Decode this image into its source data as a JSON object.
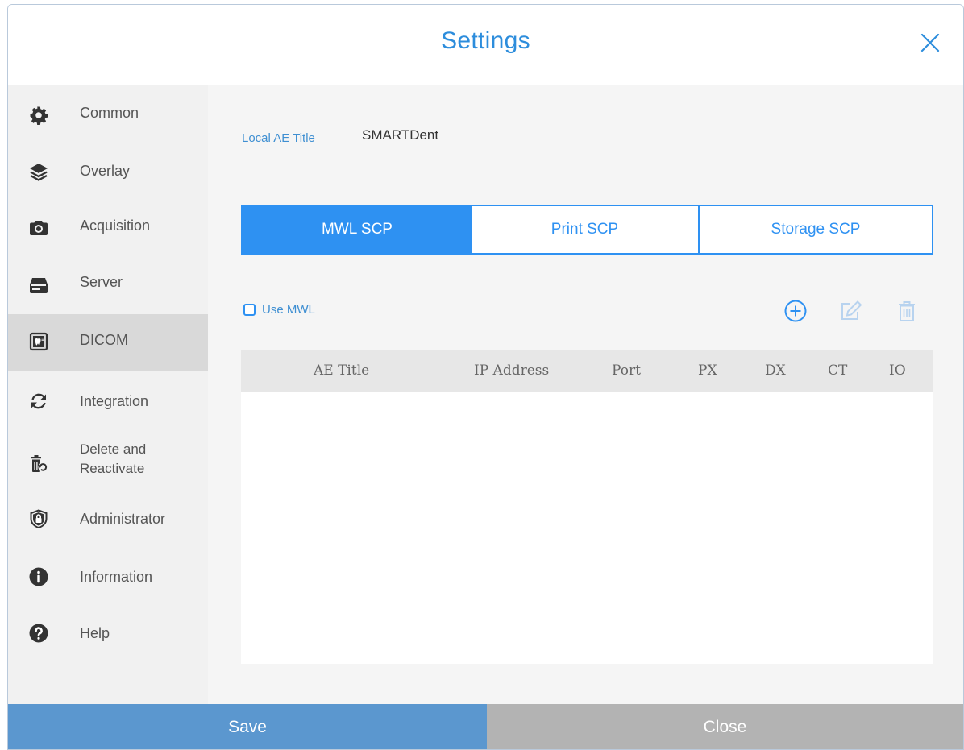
{
  "dialog": {
    "title": "Settings"
  },
  "sidebar": {
    "items": [
      {
        "label": "Common",
        "icon": "gear-icon"
      },
      {
        "label": "Overlay",
        "icon": "layers-icon"
      },
      {
        "label": "Acquisition",
        "icon": "camera-icon"
      },
      {
        "label": "Server",
        "icon": "server-icon"
      },
      {
        "label": "DICOM",
        "icon": "dicom-icon",
        "active": true
      },
      {
        "label": "Integration",
        "icon": "sync-icon"
      },
      {
        "label": "Delete and\nReactivate",
        "icon": "restore-trash-icon"
      },
      {
        "label": "Administrator",
        "icon": "shield-lock-icon"
      },
      {
        "label": "Information",
        "icon": "info-icon"
      },
      {
        "label": "Help",
        "icon": "help-icon"
      }
    ]
  },
  "main": {
    "local_ae_label": "Local AE Title",
    "local_ae_value": "SMARTDent",
    "tabs": [
      {
        "label": "MWL SCP",
        "active": true
      },
      {
        "label": "Print SCP"
      },
      {
        "label": "Storage SCP"
      }
    ],
    "use_mwl_label": "Use MWL",
    "use_mwl_checked": false,
    "table": {
      "columns": [
        "AE Title",
        "IP Address",
        "Port",
        "PX",
        "DX",
        "CT",
        "IO"
      ],
      "rows": []
    }
  },
  "footer": {
    "save_label": "Save",
    "close_label": "Close"
  },
  "colors": {
    "accent": "#2e91f2",
    "title": "#2d8ddc",
    "save_bg": "#5b97cf",
    "close_bg": "#b3b3b3",
    "sidebar_active": "#d9d9d9"
  }
}
